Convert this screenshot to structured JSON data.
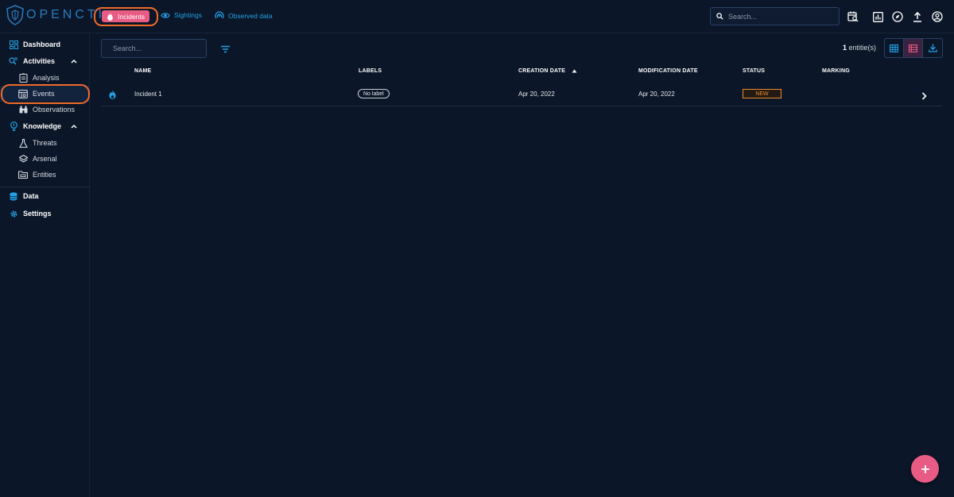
{
  "brand": {
    "logo_text": "OPENCTI"
  },
  "top_nav": {
    "incidents": "Incidents",
    "sightings": "Sightings",
    "observed_data": "Observed data"
  },
  "top_search": {
    "placeholder": "Search..."
  },
  "top_icons": [
    "search-bulk-icon",
    "dashboard-icon",
    "explore-icon",
    "upload-icon",
    "account-icon"
  ],
  "sidebar": {
    "items": [
      {
        "label": "Dashboard",
        "icon": "dashboard-icon"
      },
      {
        "label": "Activities",
        "icon": "activities-icon"
      },
      {
        "label": "Analysis",
        "icon": "analysis-icon"
      },
      {
        "label": "Events",
        "icon": "events-icon"
      },
      {
        "label": "Observations",
        "icon": "binoculars-icon"
      },
      {
        "label": "Knowledge",
        "icon": "knowledge-icon"
      },
      {
        "label": "Threats",
        "icon": "threats-icon"
      },
      {
        "label": "Arsenal",
        "icon": "arsenal-icon"
      },
      {
        "label": "Entities",
        "icon": "entities-icon"
      },
      {
        "label": "Data",
        "icon": "data-icon"
      },
      {
        "label": "Settings",
        "icon": "settings-icon"
      }
    ]
  },
  "list": {
    "search_placeholder": "Search...",
    "count_number": "1",
    "count_suffix": " entitie(s)",
    "columns": {
      "name": "NAME",
      "labels": "LABELS",
      "creation_date": "CREATION DATE",
      "modification_date": "MODIFICATION DATE",
      "status": "STATUS",
      "marking": "MARKING"
    },
    "rows": [
      {
        "name": "Incident 1",
        "label": "No label",
        "creation_date": "Apr 20, 2022",
        "modification_date": "Apr 20, 2022",
        "status": "NEW",
        "marking": ""
      }
    ]
  },
  "colors": {
    "background": "#0b1628",
    "accent_blue": "#22a3e6",
    "accent_pink": "#e85b85",
    "status_orange": "#e98a2c",
    "highlight_orange": "#ee6b2a"
  }
}
